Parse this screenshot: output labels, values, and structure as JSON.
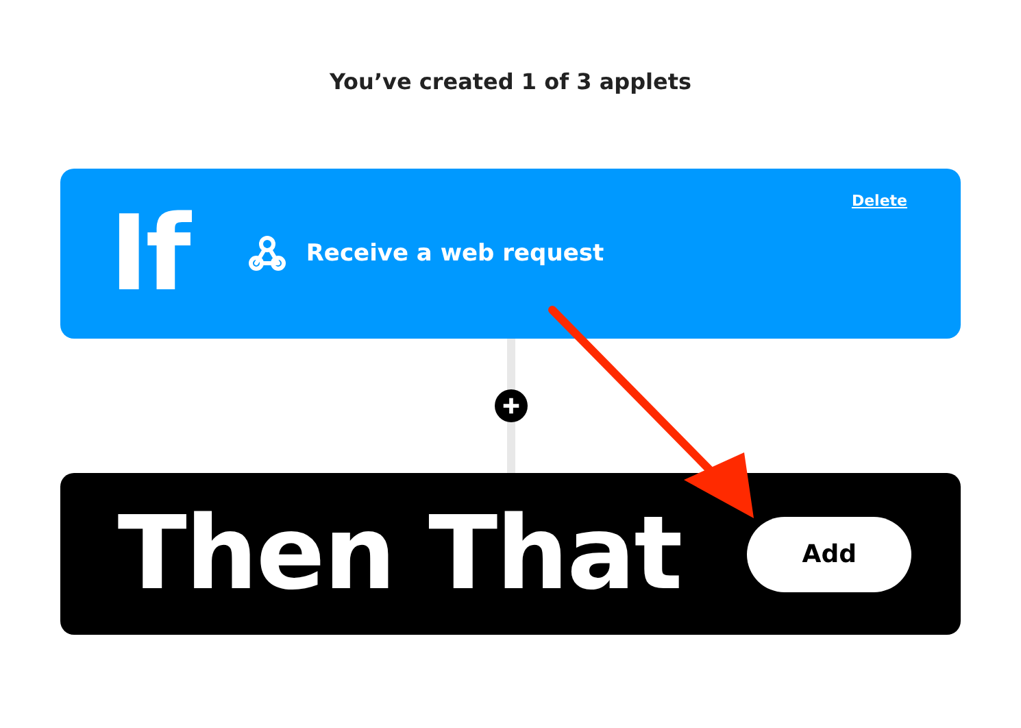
{
  "heading": "You’ve created 1 of 3 applets",
  "trigger": {
    "keyword": "If",
    "label": "Receive a web request",
    "delete_link": "Delete"
  },
  "action": {
    "keyword": "Then That",
    "button": "Add"
  }
}
